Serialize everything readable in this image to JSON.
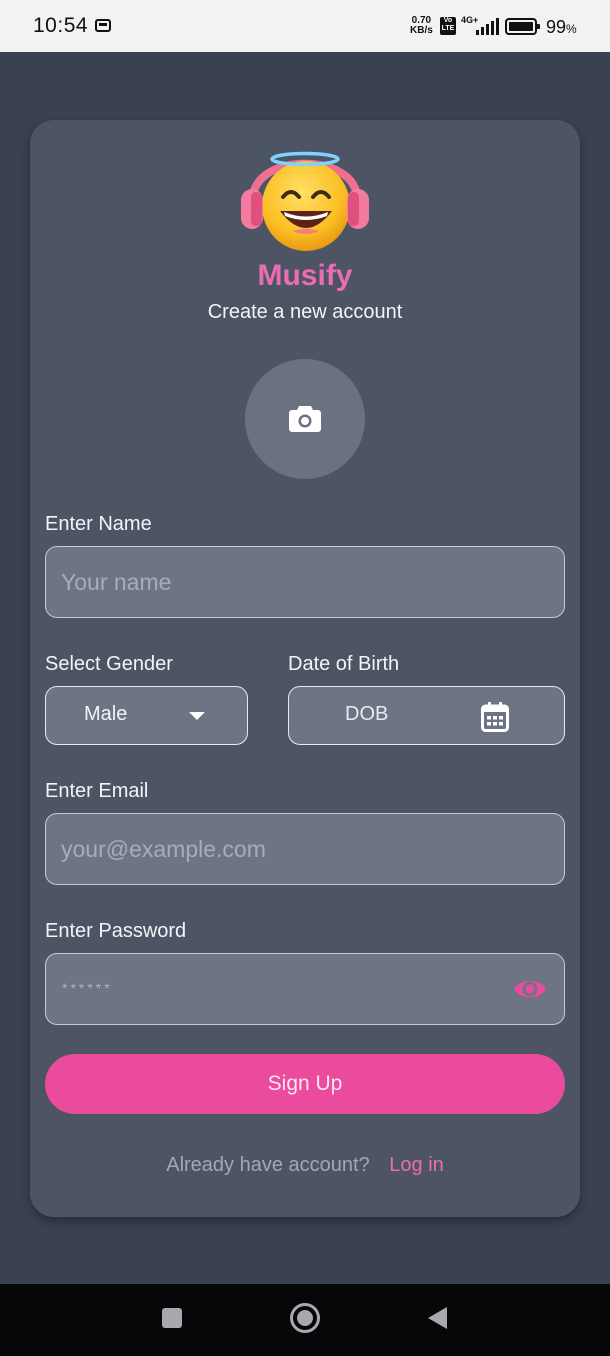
{
  "status_bar": {
    "time": "10:54",
    "net_speed_value": "0.70",
    "net_speed_unit": "KB/s",
    "volte_top": "Vo",
    "volte_bottom": "LTE",
    "network_type": "4G+",
    "battery_percent": "99",
    "battery_unit": "%",
    "battery_level": 0.99
  },
  "header": {
    "app_name": "Musify",
    "subtitle": "Create a new account",
    "logo_icon": "angel-headphones-emoji-icon"
  },
  "avatar": {
    "icon": "camera-icon"
  },
  "form": {
    "name": {
      "label": "Enter Name",
      "placeholder": "Your name",
      "value": ""
    },
    "gender": {
      "label": "Select Gender",
      "value": "Male"
    },
    "dob": {
      "label": "Date of Birth",
      "value": "DOB",
      "icon": "calendar-icon"
    },
    "email": {
      "label": "Enter Email",
      "placeholder": "your@example.com",
      "value": ""
    },
    "password": {
      "label": "Enter Password",
      "masked_value": "******",
      "icon": "eye-icon"
    }
  },
  "actions": {
    "signup_label": "Sign Up",
    "login_prompt": "Already have account?",
    "login_link": "Log in"
  },
  "colors": {
    "background": "#3a4252",
    "card": "#4d5565",
    "input_fill": "#6d7483",
    "accent_pink": "#ea4b9c",
    "brand_text": "#ec6cb3"
  },
  "nav_bar": {
    "icons": [
      "recents-square-icon",
      "home-circle-icon",
      "back-triangle-icon"
    ]
  }
}
